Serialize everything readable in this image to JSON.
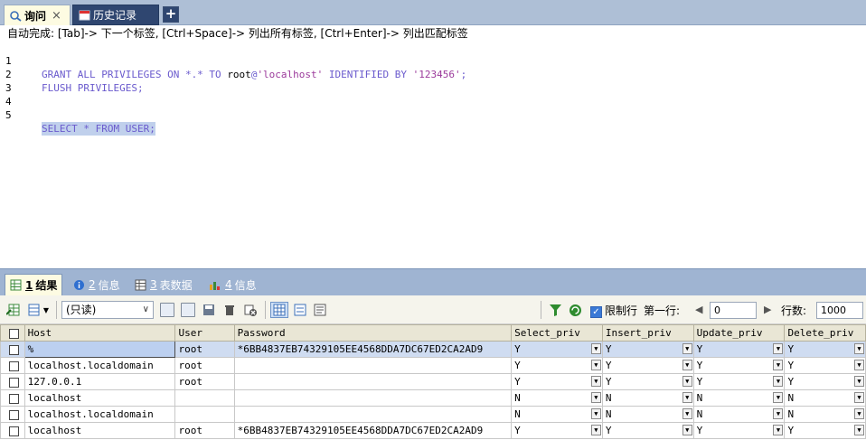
{
  "query_tabs": [
    {
      "label": "询问",
      "close": "×",
      "active": true
    },
    {
      "label": "历史记录",
      "active": false
    }
  ],
  "new_tab_label": "+",
  "autocomplete_hint": "自动完成: [Tab]-> 下一个标签, [Ctrl+Space]-> 列出所有标签, [Ctrl+Enter]-> 列出匹配标签",
  "editor": {
    "line_numbers": [
      "1",
      "2",
      "3",
      "4",
      "5"
    ],
    "line1": {
      "kw1": "GRANT ALL PRIVILEGES ON *.* TO ",
      "plain": "root",
      "at": "@",
      "str1": "'localhost'",
      "kw2": " IDENTIFIED BY ",
      "str2": "'123456'",
      "end": ";"
    },
    "line2": "FLUSH PRIVILEGES;",
    "line5": "SELECT * FROM USER;"
  },
  "result_tabs": [
    {
      "num": "1",
      "label": "结果",
      "active": true
    },
    {
      "num": "2",
      "label": "信息",
      "active": false
    },
    {
      "num": "3",
      "label": "表数据",
      "active": false
    },
    {
      "num": "4",
      "label": "信息",
      "active": false
    }
  ],
  "toolbar": {
    "mode_select": "(只读)",
    "limit_label": "限制行",
    "first_row_label": "第一行:",
    "first_row_value": "0",
    "rows_label": "行数:",
    "rows_value": "1000"
  },
  "grid": {
    "columns": [
      "Host",
      "User",
      "Password",
      "Select_priv",
      "Insert_priv",
      "Update_priv",
      "Delete_priv"
    ],
    "rows": [
      {
        "host": "%",
        "user": "root",
        "password": "*6BB4837EB74329105EE4568DDA7DC67ED2CA2AD9",
        "select": "Y",
        "insert": "Y",
        "update": "Y",
        "delete": "Y"
      },
      {
        "host": "localhost.localdomain",
        "user": "root",
        "password": "",
        "select": "Y",
        "insert": "Y",
        "update": "Y",
        "delete": "Y"
      },
      {
        "host": "127.0.0.1",
        "user": "root",
        "password": "",
        "select": "Y",
        "insert": "Y",
        "update": "Y",
        "delete": "Y"
      },
      {
        "host": "localhost",
        "user": "",
        "password": "",
        "select": "N",
        "insert": "N",
        "update": "N",
        "delete": "N"
      },
      {
        "host": "localhost.localdomain",
        "user": "",
        "password": "",
        "select": "N",
        "insert": "N",
        "update": "N",
        "delete": "N"
      },
      {
        "host": "localhost",
        "user": "root",
        "password": "*6BB4837EB74329105EE4568DDA7DC67ED2CA2AD9",
        "select": "Y",
        "insert": "Y",
        "update": "Y",
        "delete": "Y"
      }
    ]
  },
  "colors": {
    "tabbar": "#aebfd6",
    "active_tab": "#fdfbe2",
    "keyword": "#6a5acd",
    "string": "#9b3a9b",
    "selection": "#c0d0ec",
    "grid_header": "#e9e6d5"
  }
}
